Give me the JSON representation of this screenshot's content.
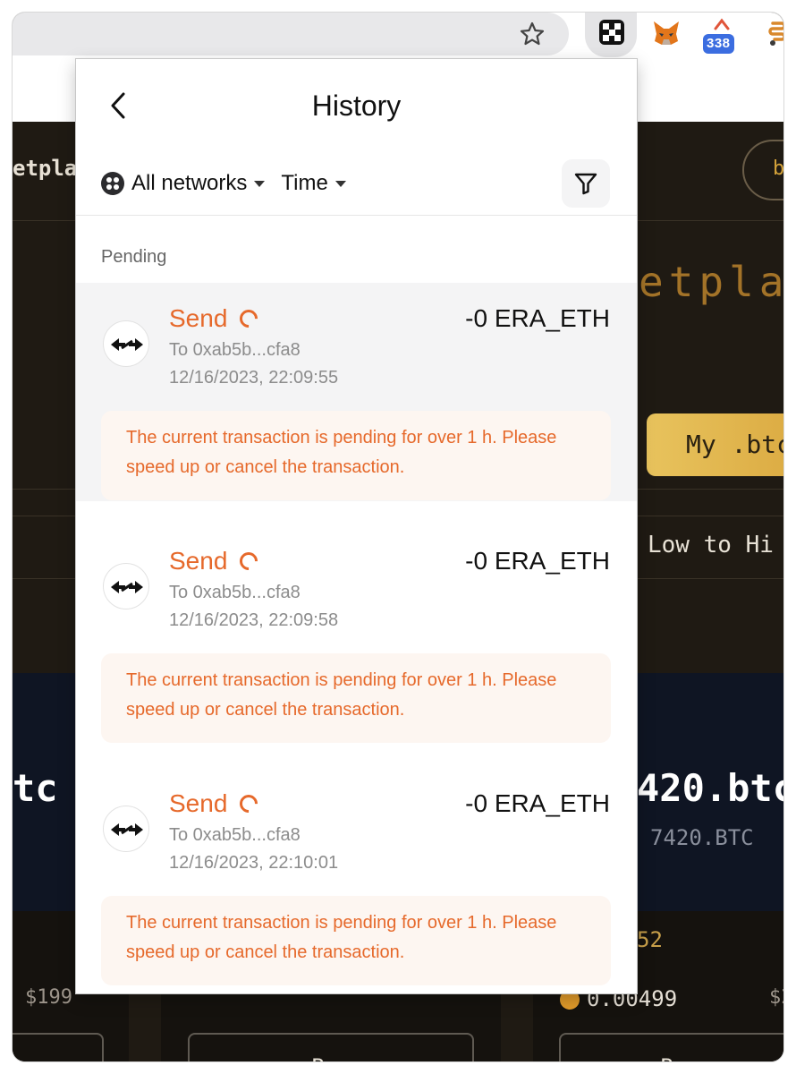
{
  "browser": {
    "extension_badge_count": "338"
  },
  "background_site": {
    "logo_fragment": "etpla",
    "nav_button_fragment": "b",
    "hero_fragment": "etpla",
    "primary_button_fragment": "My .btc",
    "sort_fragment": "Low to Hi",
    "card_left_name_fragment": "tc",
    "card_right_name_fragment": "420.btc",
    "card_right_sub": "7420.BTC",
    "card_right_number_fragment": "52",
    "price_left_fragment": "$199",
    "price_right_fragment": "$2",
    "coin_value_fragment": "0.00499",
    "buy_label": "Buy"
  },
  "popup": {
    "title": "History",
    "filters": {
      "network": "All networks",
      "sort": "Time"
    },
    "section_label": "Pending",
    "transactions": [
      {
        "type": "Send",
        "amount": "-0 ERA_ETH",
        "to": "To 0xab5b...cfa8",
        "time": "12/16/2023, 22:09:55",
        "warning": "The current transaction is pending for over 1 h. Please speed up or cancel the transaction."
      },
      {
        "type": "Send",
        "amount": "-0 ERA_ETH",
        "to": "To 0xab5b...cfa8",
        "time": "12/16/2023, 22:09:58",
        "warning": "The current transaction is pending for over 1 h. Please speed up or cancel the transaction."
      },
      {
        "type": "Send",
        "amount": "-0 ERA_ETH",
        "to": "To 0xab5b...cfa8",
        "time": "12/16/2023, 22:10:01",
        "warning": "The current transaction is pending for over 1 h. Please speed up or cancel the transaction."
      }
    ]
  },
  "icons": {
    "back": "chevron-left-icon",
    "network": "grid-dots-icon",
    "filter": "funnel-icon",
    "transaction": "swap-arrows-icon",
    "pending": "spinner-icon",
    "bookmark": "star-icon"
  },
  "colors": {
    "accent_orange": "#e6692b",
    "warning_bg": "#fdf6f1",
    "site_dark": "#1f1a13",
    "site_gold": "#e8c35d"
  }
}
